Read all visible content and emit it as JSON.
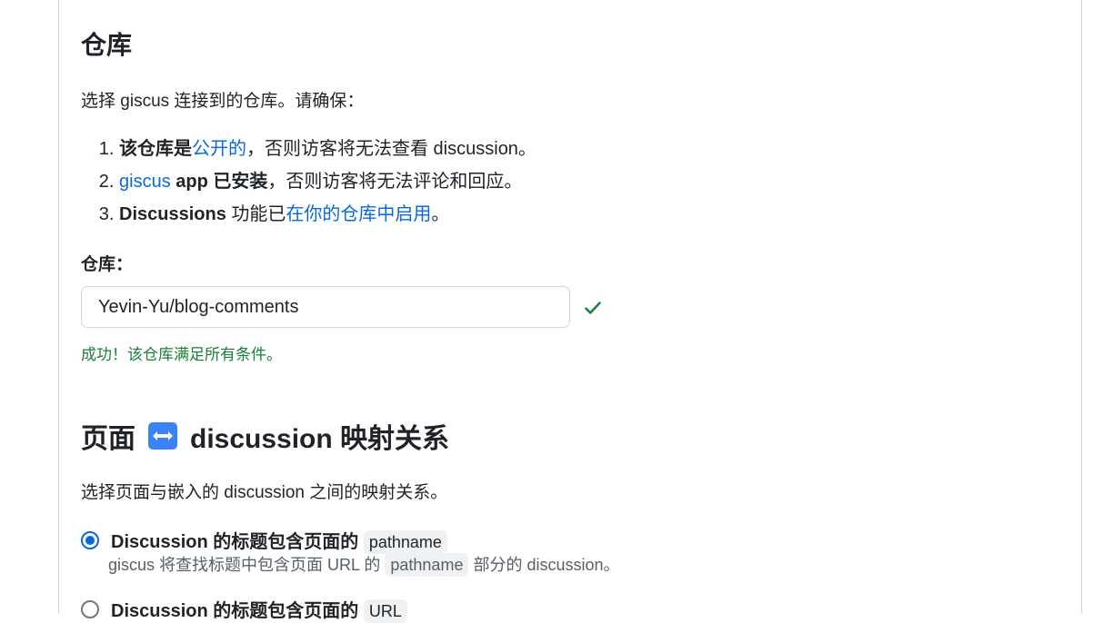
{
  "repo_section": {
    "title": "仓库",
    "intro": "选择 giscus 连接到的仓库。请确保：",
    "req1": {
      "prefix": "该仓库是",
      "link": "公开的",
      "suffix": "，否则访客将无法查看 discussion。"
    },
    "req2": {
      "link": "giscus",
      "bold": " app 已安装",
      "suffix": "，否则访客将无法评论和回应。"
    },
    "req3": {
      "bold": "Discussions",
      "mid": " 功能已",
      "link": "在你的仓库中启用",
      "suffix": "。"
    },
    "field_label": "仓库：",
    "input_value": "Yevin-Yu/blog-comments",
    "success_message": "成功！该仓库满足所有条件。"
  },
  "mapping_section": {
    "title_left": "页面",
    "title_right": "discussion 映射关系",
    "description": "选择页面与嵌入的 discussion 之间的映射关系。",
    "options": [
      {
        "label": "Discussion 的标题包含页面的",
        "code": "pathname",
        "desc_prefix": "giscus 将查找标题中包含页面 URL 的",
        "desc_code": "pathname",
        "desc_suffix": "部分的 discussion。",
        "selected": true
      },
      {
        "label": "Discussion 的标题包含页面的",
        "code": "URL",
        "selected": false
      }
    ]
  },
  "colors": {
    "link": "#0969da",
    "success": "#1a7f37",
    "arrow_emoji_bg": "#3b82f6"
  }
}
